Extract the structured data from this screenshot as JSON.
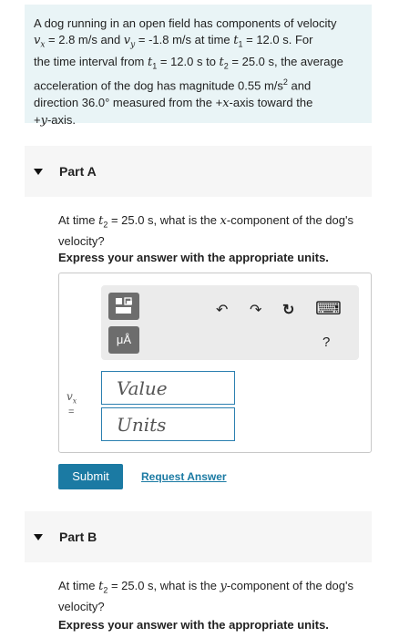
{
  "problem": {
    "line1": "A dog running in an open field has components of velocity",
    "vx_sym": "v",
    "vx_sub": "x",
    "vx_val": " = 2.8 m/s and ",
    "vy_sym": "v",
    "vy_sub": "y",
    "vy_val": " = -1.8 m/s at time ",
    "t1_sym": "t",
    "t1_sub": "1",
    "t1_val": " = 12.0 s. For",
    "line3a": "the time interval from ",
    "line3_t1": "t",
    "line3_t1sub": "1",
    "line3b": " = 12.0 s to ",
    "line3_t2": "t",
    "line3_t2sub": "2",
    "line3c": " = 25.0 s, the average",
    "line4a": "acceleration of the dog has magnitude 0.55 m/s",
    "line4_sup": "2",
    "line4b": " and",
    "line5a": "direction 36.0",
    "line5_deg": "°",
    "line5b": " measured from the +",
    "line5_x": "x",
    "line5c": "-axis toward the",
    "line6a": "+",
    "line6_y": "y",
    "line6b": "-axis."
  },
  "partA": {
    "title": "Part A",
    "q1a": "At time ",
    "q1_t": "t",
    "q1_tsub": "2",
    "q1b": " = 25.0 s, what is the ",
    "q1_x": "x",
    "q1c": "-component of the dog's",
    "q2": "velocity?",
    "instruction": "Express your answer with the appropriate units.",
    "unit_button": "μÅ",
    "help": "?",
    "var_label": "v",
    "var_sub": "x",
    "eq": "=",
    "value_placeholder": "Value",
    "units_placeholder": "Units",
    "submit": "Submit",
    "request": "Request Answer"
  },
  "partB": {
    "title": "Part B",
    "q1a": "At time ",
    "q1_t": "t",
    "q1_tsub": "2",
    "q1b": " = 25.0 s, what is the ",
    "q1_y": "y",
    "q1c": "-component of the dog's",
    "q2": "velocity?",
    "instruction": "Express your answer with the appropriate units."
  },
  "icons": {
    "undo": "↶",
    "redo": "↷",
    "reset": "↻",
    "keyboard": "⌨"
  }
}
